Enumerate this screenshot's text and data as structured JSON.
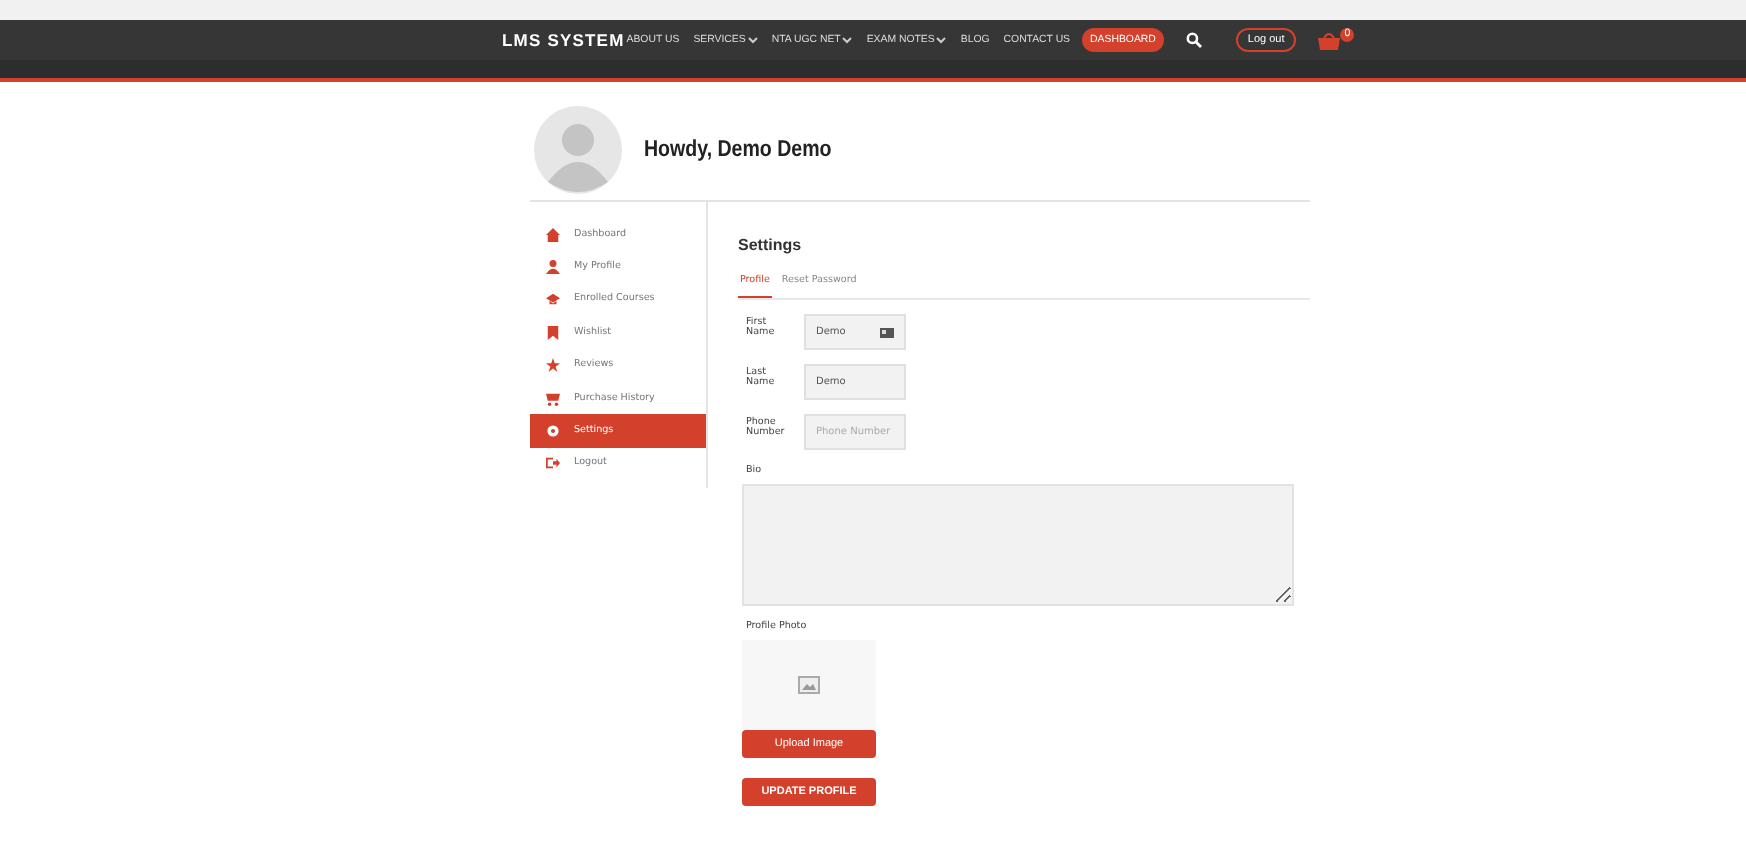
{
  "header": {
    "logo": "LMS SYSTEM",
    "nav": [
      {
        "label": "ABOUT US",
        "dropdown": false,
        "selected": false
      },
      {
        "label": "SERVICES",
        "dropdown": true,
        "selected": false
      },
      {
        "label": "NTA UGC NET",
        "dropdown": true,
        "selected": false
      },
      {
        "label": "EXAM NOTES",
        "dropdown": true,
        "selected": false
      },
      {
        "label": "BLOG",
        "dropdown": false,
        "selected": false
      },
      {
        "label": "CONTACT US",
        "dropdown": false,
        "selected": false
      },
      {
        "label": "DASHBOARD",
        "dropdown": false,
        "selected": true
      }
    ],
    "logout": "Log out",
    "cart_count": "0"
  },
  "greeting": "Howdy, Demo Demo",
  "sidebar": {
    "items": [
      {
        "label": "Dashboard",
        "kind": "home",
        "selected": false
      },
      {
        "label": "My Profile",
        "kind": "user",
        "selected": false
      },
      {
        "label": "Enrolled Courses",
        "kind": "cap",
        "selected": false
      },
      {
        "label": "Wishlist",
        "kind": "bookmark",
        "selected": false
      },
      {
        "label": "Reviews",
        "kind": "star",
        "selected": false
      },
      {
        "label": "Purchase History",
        "kind": "cart",
        "selected": false
      },
      {
        "label": "Settings",
        "kind": "gear",
        "selected": true
      },
      {
        "label": "Logout",
        "kind": "exit",
        "selected": false
      }
    ]
  },
  "settings": {
    "title": "Settings",
    "tabs": [
      {
        "label": "Profile",
        "selected": true
      },
      {
        "label": "Reset Password",
        "selected": false
      }
    ],
    "fields": [
      {
        "label": "First Name",
        "value": "Demo",
        "card_icon": true
      },
      {
        "label": "Last Name",
        "value": "Demo",
        "card_icon": false
      },
      {
        "label": "Phone Number",
        "placeholder": "Phone Number",
        "card_icon": false
      }
    ],
    "bio_label": "Bio",
    "photo_label": "Profile Photo",
    "upload_button": "Upload Image",
    "submit_button": "UPDATE PROFILE"
  }
}
